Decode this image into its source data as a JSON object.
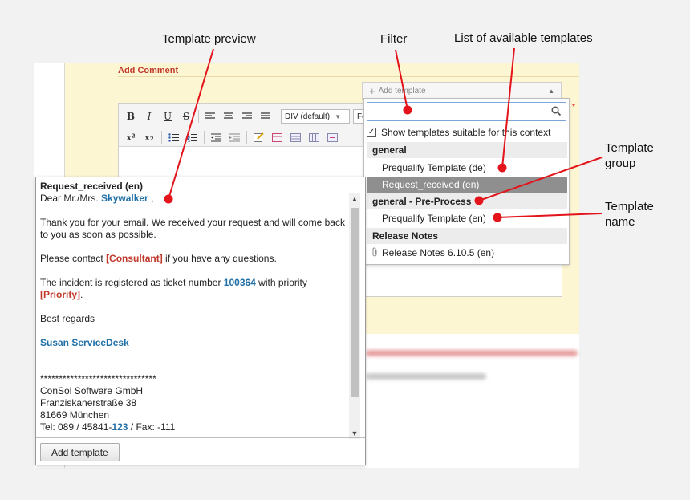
{
  "annotations": {
    "template_preview": "Template preview",
    "filter": "Filter",
    "list_of_templates": "List of available templates",
    "template_group_l1": "Template",
    "template_group_l2": "group",
    "template_name_l1": "Template",
    "template_name_l2": "name"
  },
  "form": {
    "section_title": "Add Comment",
    "required_marker": "*"
  },
  "editor": {
    "toolbar_row1": [
      "B",
      "I",
      "U",
      "S"
    ],
    "format_select": "DIV (default)",
    "font_select": "Fo",
    "superscript": "x²",
    "subscript": "x₂"
  },
  "template_picker": {
    "trigger_label": "Add template",
    "search_value": "",
    "filter_checkbox_label": "Show templates suitable for this context",
    "filter_checked": true,
    "groups": [
      {
        "name": "general",
        "items": [
          {
            "label": "Prequalify Template (de)",
            "selected": false
          },
          {
            "label": "Request_received (en)",
            "selected": true
          }
        ]
      },
      {
        "name": "general - Pre-Process",
        "items": [
          {
            "label": "Prequalify Template (en)",
            "selected": false
          }
        ]
      },
      {
        "name": "Release Notes",
        "items": [
          {
            "label": "Release Notes 6.10.5 (en)",
            "selected": false,
            "attachment": true
          }
        ]
      }
    ]
  },
  "preview": {
    "title": "Request_received (en)",
    "greeting_prefix": "Dear Mr./Mrs.",
    "greeting_name": "Skywalker",
    "greeting_suffix": " ,",
    "para1": "Thank you for your email. We received your request and will come back to you as soon as possible.",
    "para2_prefix": "Please contact",
    "para2_var": "[Consultant]",
    "para2_suffix": " if you have any questions.",
    "para3_prefix": "The incident is registered as ticket number",
    "para3_ticket": "100364",
    "para3_mid": " with priority",
    "para3_var": "[Priority]",
    "para3_end": ".",
    "closing": "Best regards",
    "signature_name": "Susan ServiceDesk",
    "stars": "*******************************",
    "company": "ConSol Software GmbH",
    "street": "Franziskanerstraße 38",
    "city": "81669 München",
    "tel_prefix": "Tel: 089 / 45841-",
    "tel_ext": "123",
    "tel_suffix": " / Fax: -111",
    "add_button": "Add template"
  },
  "colors": {
    "annotation_line": "#e3141b",
    "panel_yellow": "#fdf6d3",
    "variable_red": "#c0392b",
    "variable_blue": "#1f6fa8",
    "selected_item": "#8f8f8f"
  }
}
